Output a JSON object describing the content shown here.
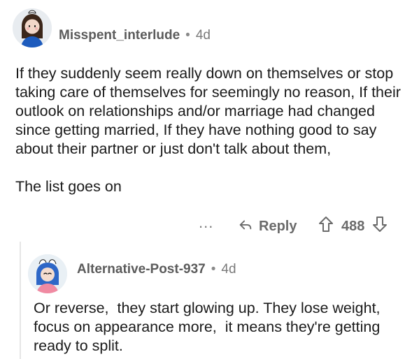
{
  "comments": [
    {
      "username": "Misspent_interlude",
      "age": "4d",
      "text": "If they suddenly seem really down on themselves or stop taking care of themselves for seemingly no reason, If their outlook on relationships and/or marriage had changed since getting married, If they have nothing good to say about their partner or just don't talk about them,\n\nThe list goes on",
      "actions": {
        "more": "...",
        "reply_label": "Reply",
        "vote_count": "488"
      }
    },
    {
      "username": "Alternative-Post-937",
      "age": "4d",
      "text": "Or reverse,  they start glowing up. They lose weight,  focus on appearance more,  it means they're getting ready to split."
    }
  ],
  "meta": {
    "separator": "•"
  },
  "icons": {
    "reply": "reply-arrow-icon",
    "upvote": "upvote-arrow-icon",
    "downvote": "downvote-arrow-icon",
    "more": "more-dots-icon",
    "avatar_1": "avatar-illustration",
    "avatar_2": "avatar-illustration"
  },
  "colors": {
    "text_primary": "#1a1a1a",
    "text_secondary": "#7a7a7a",
    "thread_line": "#e6e6e6"
  }
}
